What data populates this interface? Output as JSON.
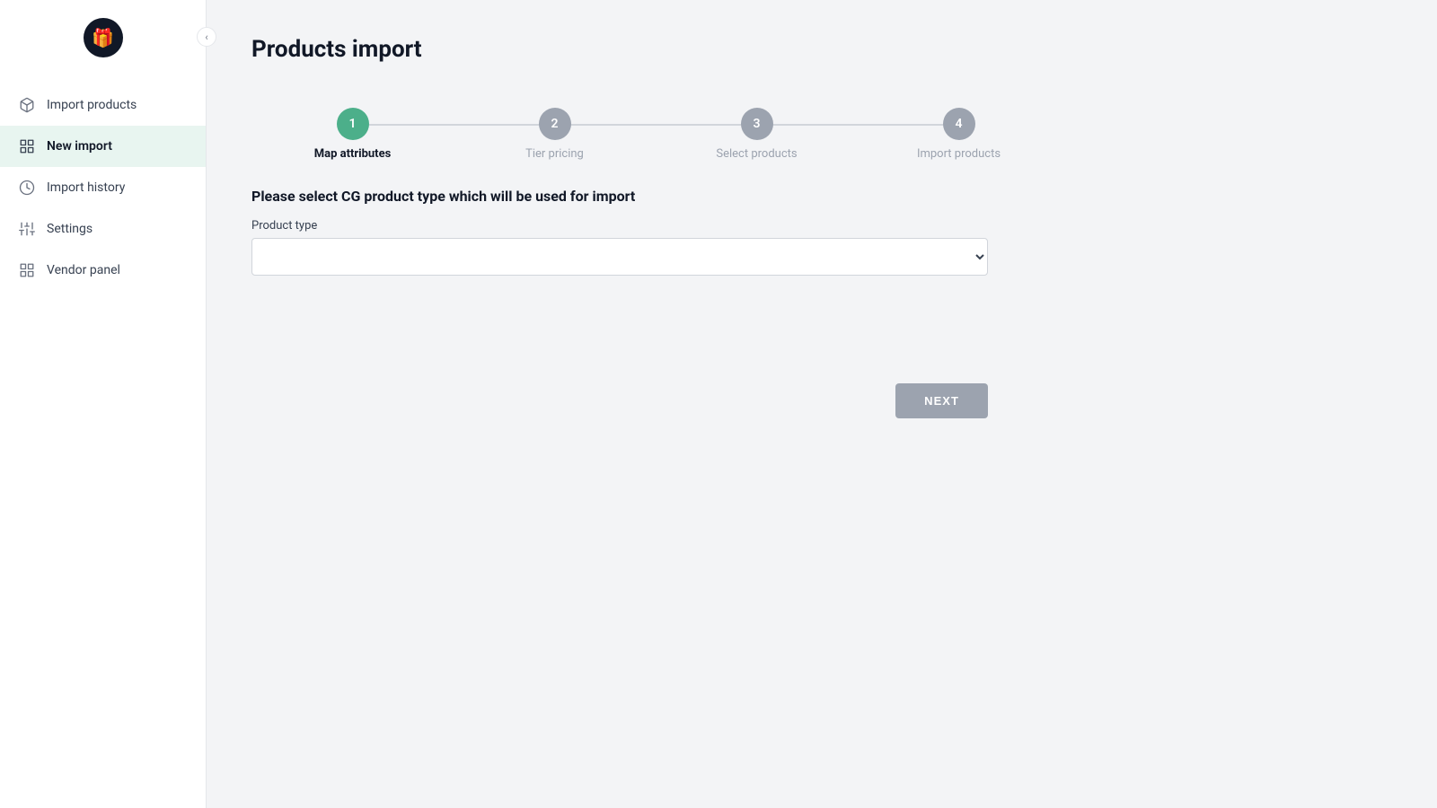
{
  "app": {
    "logo_icon": "🎁",
    "title": "Products import"
  },
  "sidebar": {
    "items": [
      {
        "id": "import-products",
        "label": "Import products",
        "icon": "package",
        "active": false
      },
      {
        "id": "new-import",
        "label": "New import",
        "icon": "plus-square",
        "active": true
      },
      {
        "id": "import-history",
        "label": "Import history",
        "icon": "clock",
        "active": false
      },
      {
        "id": "settings",
        "label": "Settings",
        "icon": "sliders",
        "active": false
      },
      {
        "id": "vendor-panel",
        "label": "Vendor panel",
        "icon": "grid",
        "active": false
      }
    ],
    "collapse_label": "‹"
  },
  "stepper": {
    "steps": [
      {
        "number": "1",
        "label": "Map attributes",
        "active": true
      },
      {
        "number": "2",
        "label": "Tier pricing",
        "active": false
      },
      {
        "number": "3",
        "label": "Select products",
        "active": false
      },
      {
        "number": "4",
        "label": "Import products",
        "active": false
      }
    ]
  },
  "form": {
    "heading": "Please select CG product type which will be used for import",
    "product_type_label": "Product type",
    "product_type_placeholder": "",
    "product_type_options": []
  },
  "actions": {
    "next_label": "NEXT"
  }
}
